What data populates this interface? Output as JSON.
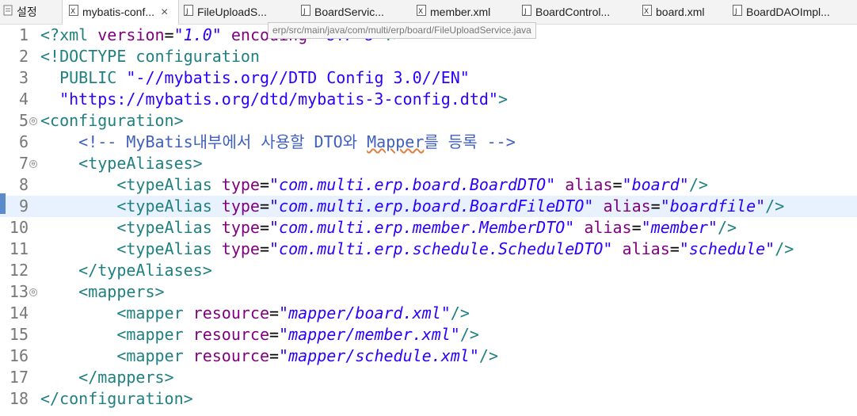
{
  "tabs": [
    {
      "label": "설정",
      "icon": "settings-icon"
    },
    {
      "label": "mybatis-conf...",
      "icon": "xml-file-icon",
      "active": true
    },
    {
      "label": "FileUploadS...",
      "icon": "java-file-icon"
    },
    {
      "label": "BoardServic...",
      "icon": "java-file-icon"
    },
    {
      "label": "member.xml",
      "icon": "xml-file-icon"
    },
    {
      "label": "BoardControl...",
      "icon": "java-file-icon"
    },
    {
      "label": "board.xml",
      "icon": "xml-file-icon"
    },
    {
      "label": "BoardDAOImpl...",
      "icon": "java-file-icon"
    }
  ],
  "tooltip": "erp/src/main/java/com/multi/erp/board/FileUploadService.java",
  "editor": {
    "current_line": 9,
    "lines": [
      {
        "n": "1"
      },
      {
        "n": "2"
      },
      {
        "n": "3"
      },
      {
        "n": "4"
      },
      {
        "n": "5"
      },
      {
        "n": "6"
      },
      {
        "n": "7"
      },
      {
        "n": "8"
      },
      {
        "n": "9"
      },
      {
        "n": "10"
      },
      {
        "n": "11"
      },
      {
        "n": "12"
      },
      {
        "n": "13"
      },
      {
        "n": "14"
      },
      {
        "n": "15"
      },
      {
        "n": "16"
      },
      {
        "n": "17"
      },
      {
        "n": "18"
      }
    ],
    "code": {
      "l1": {
        "open": "<?xml ",
        "a1": "version",
        "eq1": "=",
        "v1": "\"1.0\"",
        "sp": " ",
        "a2": "encoding",
        "eq2": "=",
        "v2": "\"UTF-8\"",
        "close": "?>"
      },
      "l2": {
        "text": "<!DOCTYPE configuration"
      },
      "l3": {
        "pub": "  PUBLIC ",
        "s": "\"-//mybatis.org//DTD Config 3.0//EN\""
      },
      "l4": {
        "s": "  \"https://mybatis.org/dtd/mybatis-3-config.dtd\"",
        "close": ">"
      },
      "l5": {
        "text": "<configuration>"
      },
      "l6": {
        "c1": "    <!-- MyBatis내부에서 사용할 DTO와 ",
        "w": "Mapper",
        "c2": "를 등록 -->"
      },
      "l7": {
        "text": "    <typeAliases>"
      },
      "l8": {
        "open": "        <typeAlias ",
        "a1": "type",
        "v1": "\"com.multi.erp.board.BoardDTO\"",
        "a2": "alias",
        "v2": "\"board\"",
        "close": "/>"
      },
      "l9": {
        "open": "        <typeAlias ",
        "a1": "type",
        "v1": "\"com.multi.erp.board.BoardFileDTO\"",
        "a2": "alias",
        "v2": "\"boardfile\"",
        "close": "/>"
      },
      "l10": {
        "open": "        <typeAlias ",
        "a1": "type",
        "v1": "\"com.multi.erp.member.MemberDTO\"",
        "a2": "alias",
        "v2": "\"member\"",
        "close": "/>"
      },
      "l11": {
        "open": "        <typeAlias ",
        "a1": "type",
        "v1": "\"com.multi.erp.schedule.ScheduleDTO\"",
        "a2": "alias",
        "v2": "\"schedule\"",
        "close": "/>"
      },
      "l12": {
        "text": "    </typeAliases>"
      },
      "l13": {
        "text": "    <mappers>"
      },
      "l14": {
        "open": "        <mapper ",
        "a1": "resource",
        "v1": "\"mapper/board.xml\"",
        "close": "/>"
      },
      "l15": {
        "open": "        <mapper ",
        "a1": "resource",
        "v1": "\"mapper/member.xml\"",
        "close": "/>"
      },
      "l16": {
        "open": "        <mapper ",
        "a1": "resource",
        "v1": "\"mapper/schedule.xml\"",
        "close": "/>"
      },
      "l17": {
        "text": "    </mappers>"
      },
      "l18": {
        "text": "</configuration>"
      }
    }
  }
}
